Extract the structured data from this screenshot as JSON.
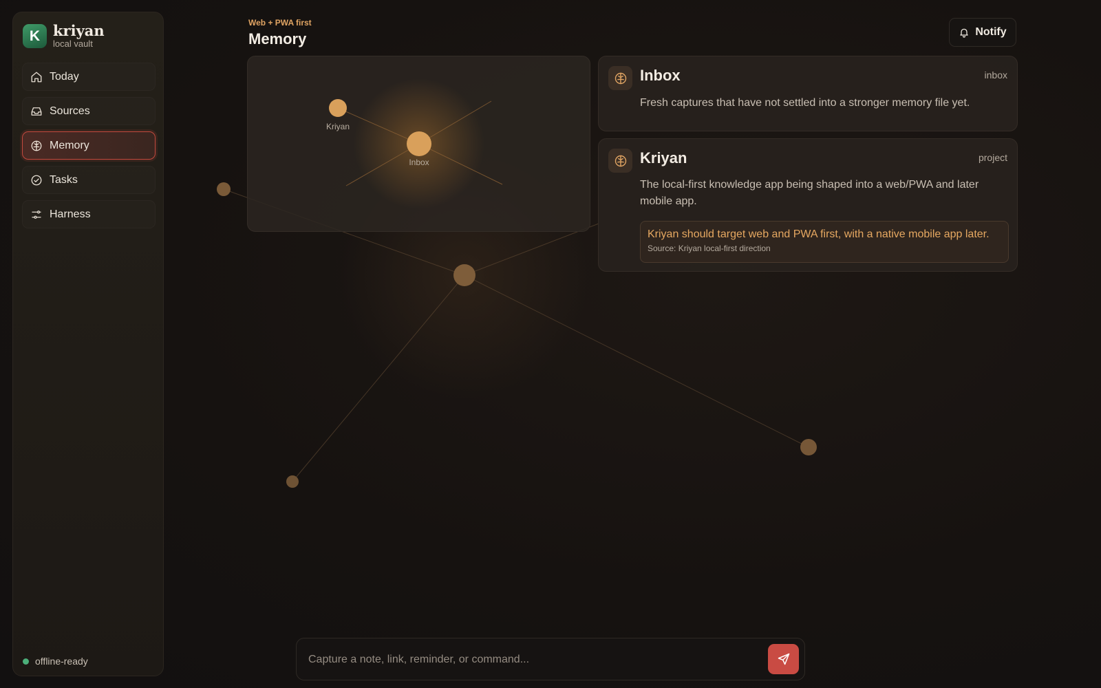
{
  "brand": {
    "logo_letter": "K",
    "name": "kriyan",
    "subtitle": "local vault"
  },
  "sidebar": {
    "items": [
      {
        "label": "Today",
        "icon": "home-icon",
        "active": false
      },
      {
        "label": "Sources",
        "icon": "inbox-tray-icon",
        "active": false
      },
      {
        "label": "Memory",
        "icon": "brain-icon",
        "active": true
      },
      {
        "label": "Tasks",
        "icon": "check-circle-icon",
        "active": false
      },
      {
        "label": "Harness",
        "icon": "sliders-icon",
        "active": false
      }
    ],
    "status": {
      "label": "offline-ready",
      "color": "#4caf7a"
    }
  },
  "header": {
    "eyebrow": "Web + PWA first",
    "title": "Memory",
    "notify_label": "Notify"
  },
  "graph_preview": {
    "nodes": [
      {
        "label": "Kriyan"
      },
      {
        "label": "Inbox"
      }
    ]
  },
  "cards": [
    {
      "title": "Inbox",
      "tag": "inbox",
      "icon": "brain-icon",
      "body": "Fresh captures that have not settled into a stronger memory file yet."
    },
    {
      "title": "Kriyan",
      "tag": "project",
      "icon": "brain-icon",
      "body": "The local-first knowledge app being shaped into a web/PWA and later mobile app.",
      "fact": {
        "text": "Kriyan should target web and PWA first, with a native mobile app later.",
        "source": "Source: Kriyan local-first direction"
      }
    }
  ],
  "capture": {
    "placeholder": "Capture a note, link, reminder, or command..."
  },
  "colors": {
    "accent": "#e0a463",
    "active_border": "#c4493e",
    "send_button": "#c94b43",
    "node": "#d9a05b"
  }
}
